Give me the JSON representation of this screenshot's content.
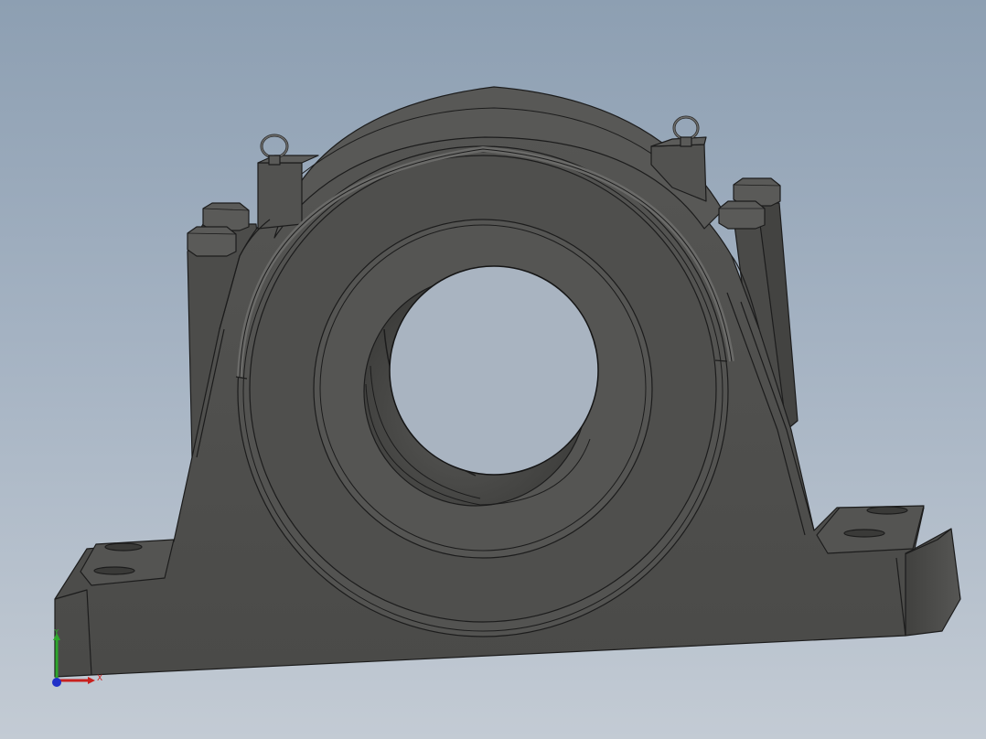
{
  "viewport": {
    "background_top": "#8d9fb2",
    "background_bottom": "#c3cbd4",
    "model_color": "#4e4e4c",
    "edge_color": "#1a1a1a"
  },
  "triad": {
    "x_label": "X",
    "y_label": "Y",
    "x_color": "#c8201e",
    "y_color": "#2da62b",
    "z_color": "#2030c8"
  }
}
